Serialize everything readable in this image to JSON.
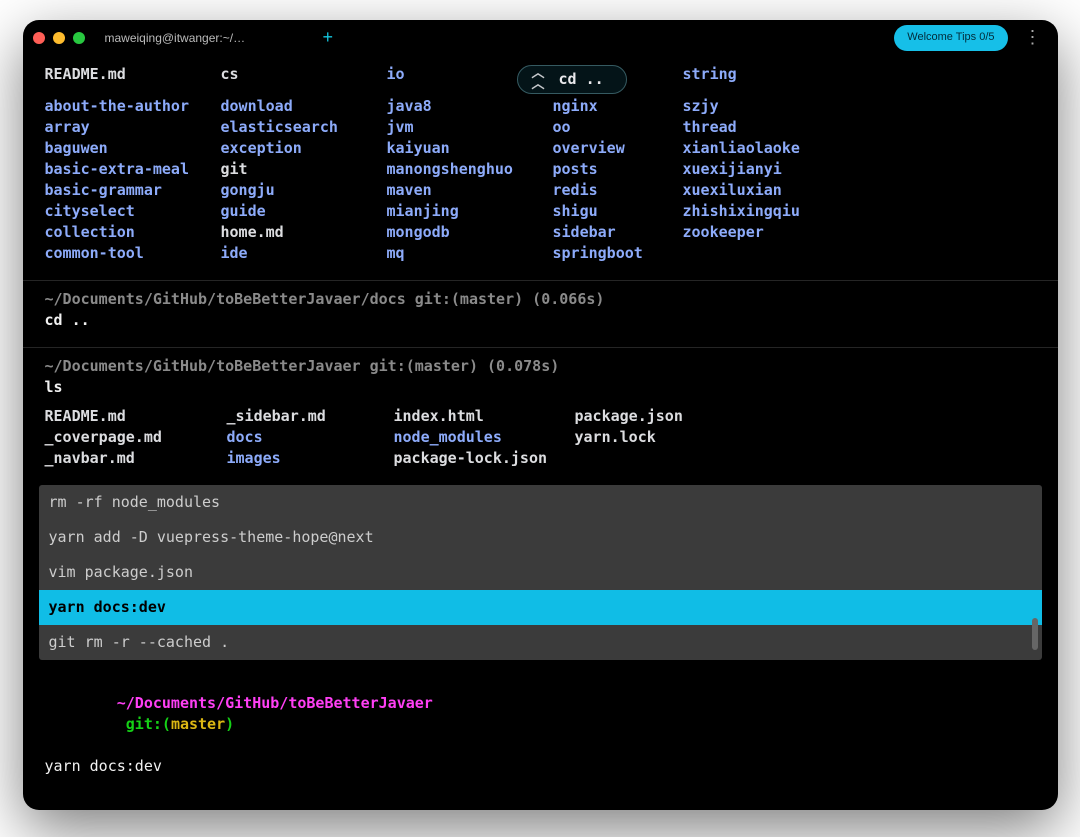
{
  "titlebar": {
    "tab": "maweiqing@itwanger:~/Documents/GitHub/toBeBetterJavaer",
    "tips": "Welcome Tips 0/5"
  },
  "topListing": {
    "bubble": "cd ..",
    "items": [
      [
        "README.md",
        "file"
      ],
      [
        "cs",
        "file"
      ],
      [
        "io",
        "dir"
      ],
      [
        "",
        "bubble"
      ],
      [
        "",
        "spacer"
      ],
      [
        "string",
        "dir"
      ],
      [
        "about-the-author",
        "dir"
      ],
      [
        "download",
        "dir"
      ],
      [
        "java8",
        "dir"
      ],
      [
        "",
        "spacer2"
      ],
      [
        "nginx",
        "dir"
      ],
      [
        "szjy",
        "dir"
      ],
      [
        "array",
        "dir"
      ],
      [
        "elasticsearch",
        "dir"
      ],
      [
        "jvm",
        "dir"
      ],
      [
        "",
        "spacer2"
      ],
      [
        "oo",
        "dir"
      ],
      [
        "thread",
        "dir"
      ],
      [
        "baguwen",
        "dir"
      ],
      [
        "exception",
        "dir"
      ],
      [
        "kaiyuan",
        "dir"
      ],
      [
        "",
        "spacer2"
      ],
      [
        "overview",
        "dir"
      ],
      [
        "xianliaolaoke",
        "dir"
      ],
      [
        "basic-extra-meal",
        "dir"
      ],
      [
        "git",
        "file"
      ],
      [
        "manongshenghuo",
        "dir"
      ],
      [
        "",
        "spacer2"
      ],
      [
        "posts",
        "dir"
      ],
      [
        "xuexijianyi",
        "dir"
      ],
      [
        "basic-grammar",
        "dir"
      ],
      [
        "gongju",
        "dir"
      ],
      [
        "maven",
        "dir"
      ],
      [
        "",
        "spacer2"
      ],
      [
        "redis",
        "dir"
      ],
      [
        "xuexiluxian",
        "dir"
      ],
      [
        "cityselect",
        "dir"
      ],
      [
        "guide",
        "dir"
      ],
      [
        "mianjing",
        "dir"
      ],
      [
        "",
        "spacer2"
      ],
      [
        "shigu",
        "dir"
      ],
      [
        "zhishixingqiu",
        "dir"
      ],
      [
        "collection",
        "dir"
      ],
      [
        "home.md",
        "file"
      ],
      [
        "mongodb",
        "dir"
      ],
      [
        "",
        "spacer2"
      ],
      [
        "sidebar",
        "dir"
      ],
      [
        "zookeeper",
        "dir"
      ],
      [
        "common-tool",
        "dir"
      ],
      [
        "ide",
        "dir"
      ],
      [
        "mq",
        "dir"
      ],
      [
        "",
        "spacer2"
      ],
      [
        "springboot",
        "dir"
      ],
      [
        "",
        "spacer2"
      ]
    ]
  },
  "prompt1": {
    "path": "~/Documents/GitHub/toBeBetterJavaer/docs git:(master) (0.066s)",
    "cmd": "cd .."
  },
  "prompt2": {
    "path": "~/Documents/GitHub/toBeBetterJavaer git:(master) (0.078s)",
    "cmd": "ls",
    "listing": [
      [
        "README.md",
        "file"
      ],
      [
        "_sidebar.md",
        "file"
      ],
      [
        "index.html",
        "file"
      ],
      [
        "package.json",
        "file"
      ],
      [
        "_coverpage.md",
        "file"
      ],
      [
        "docs",
        "dir"
      ],
      [
        "node_modules",
        "dir"
      ],
      [
        "yarn.lock",
        "file"
      ],
      [
        "_navbar.md",
        "file"
      ],
      [
        "images",
        "dir"
      ],
      [
        "package-lock.json",
        "file"
      ],
      [
        "",
        "spacer"
      ]
    ]
  },
  "history": {
    "items": [
      "rm -rf node_modules",
      "yarn add -D vuepress-theme-hope@next",
      "vim package.json",
      "yarn docs:dev",
      "git rm -r --cached ."
    ],
    "selected": 3
  },
  "current": {
    "path": "~/Documents/GitHub/toBeBetterJavaer",
    "git_label": "git:",
    "branch": "master",
    "input": "yarn docs:dev"
  }
}
